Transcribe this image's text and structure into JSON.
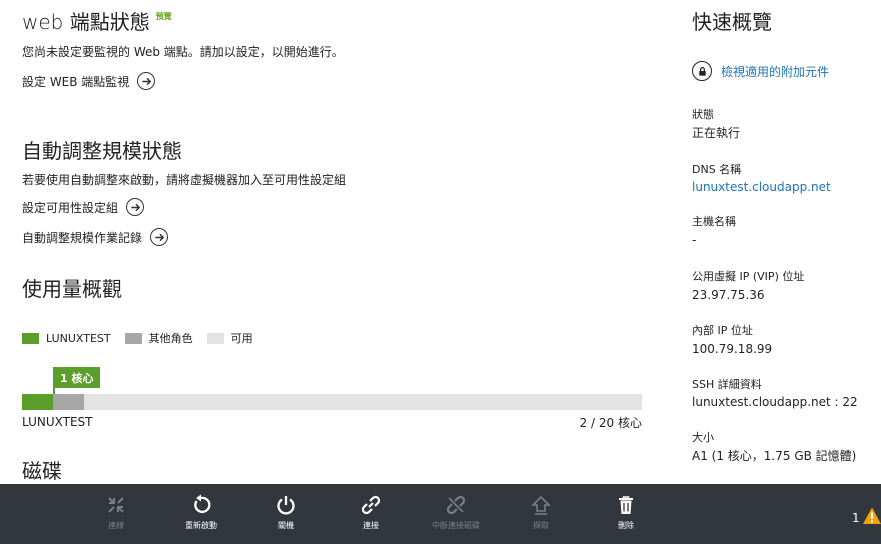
{
  "main": {
    "web_endpoint": {
      "title": "web 端點狀態",
      "badge": "預覽",
      "description": "您尚未設定要監視的 Web 端點。請加以設定，以開始進行。",
      "link": "設定 WEB 端點監視"
    },
    "autoscale": {
      "title": "自動調整規模狀態",
      "description": "若要使用自動調整來啟動，請將虛擬機器加入至可用性設定組",
      "link_availability": "設定可用性設定組",
      "link_log": "自動調整規模作業記錄"
    },
    "usage": {
      "title": "使用量概觀",
      "legend": [
        {
          "label": "LUNUXTEST",
          "color": "#5c9e2b"
        },
        {
          "label": "其他角色",
          "color": "#a6a6a6"
        },
        {
          "label": "可用",
          "color": "#e3e3e3"
        }
      ],
      "tag": "1 核心",
      "segments": [
        {
          "name": "lunuxtest",
          "cores": 1,
          "color": "#5c9e2b"
        },
        {
          "name": "other-roles",
          "cores": 1,
          "color": "#a6a6a6"
        }
      ],
      "used_cores": 2,
      "total_cores": 20,
      "role_label": "LUNUXTEST",
      "summary": "2 / 20 核心"
    },
    "disks": {
      "title": "磁碟"
    }
  },
  "side": {
    "title": "快速概覽",
    "addon_link": "檢視適用的附加元件",
    "status_label": "狀態",
    "status_value": "正在執行",
    "dns_label": "DNS 名稱",
    "dns_value": "lunuxtest.cloudapp.net",
    "host_label": "主機名稱",
    "host_value": "-",
    "vip_label": "公用虛擬 IP (VIP) 位址",
    "vip_value": "23.97.75.36",
    "internal_ip_label": "內部 IP 位址",
    "internal_ip_value": "100.79.18.99",
    "ssh_label": "SSH 詳細資料",
    "ssh_value": "lunuxtest.cloudapp.net : 22",
    "size_label": "大小",
    "size_value": "A1 (1 核心，1.75 GB 記憶體)"
  },
  "commandbar": {
    "commands": [
      {
        "label": "連線",
        "icon": "connect-icon",
        "enabled": false
      },
      {
        "label": "重新啟動",
        "icon": "restart-icon",
        "enabled": true
      },
      {
        "label": "關機",
        "icon": "shutdown-icon",
        "enabled": true
      },
      {
        "label": "連接",
        "icon": "attach-icon",
        "enabled": true
      },
      {
        "label": "中斷連接磁碟",
        "icon": "detach-icon",
        "enabled": false
      },
      {
        "label": "擷取",
        "icon": "capture-icon",
        "enabled": false
      },
      {
        "label": "刪除",
        "icon": "delete-icon",
        "enabled": true
      }
    ],
    "notification_count": "1",
    "colors": {
      "bar": "#32373d",
      "warning": "#f0a30a"
    }
  }
}
